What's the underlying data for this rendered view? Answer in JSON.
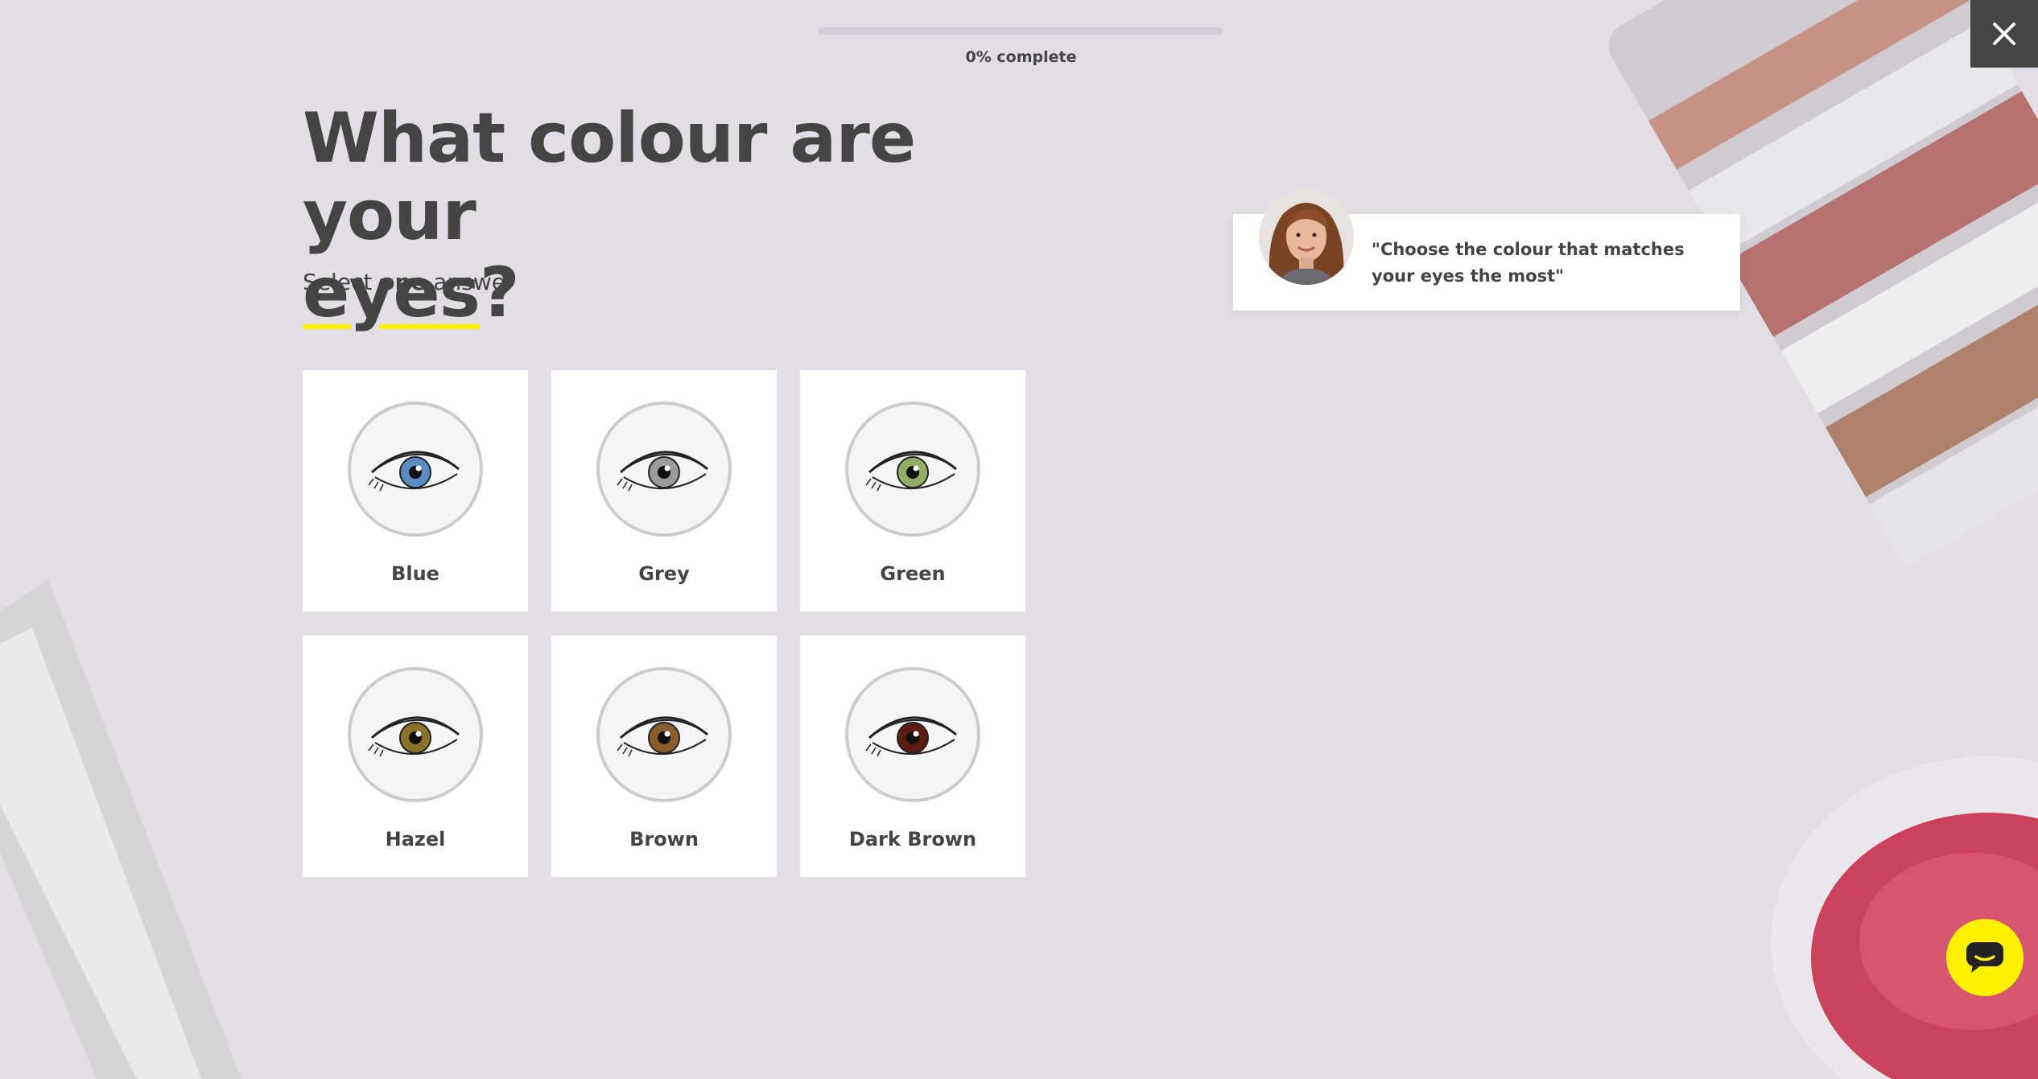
{
  "progress": {
    "text": "0% complete",
    "percent": 0
  },
  "question": {
    "title_part1": "What colour are your",
    "title_highlight": "eyes",
    "title_end": "?",
    "subtitle_before": "Select",
    "subtitle_bold": "one",
    "subtitle_after": "answer"
  },
  "options": [
    {
      "label": "Blue",
      "iris_color": "#5b8bbf"
    },
    {
      "label": "Grey",
      "iris_color": "#9a9a9a"
    },
    {
      "label": "Green",
      "iris_color": "#93ad64"
    },
    {
      "label": "Hazel",
      "iris_color": "#8a7128"
    },
    {
      "label": "Brown",
      "iris_color": "#8a5c2e"
    },
    {
      "label": "Dark Brown",
      "iris_color": "#5a1c0e"
    }
  ],
  "tip": {
    "text": "\"Choose the colour that matches your eyes the most\""
  },
  "icons": {
    "close": "close-icon",
    "chat": "chat-icon"
  },
  "colors": {
    "background": "#e3dee6",
    "text": "#444444",
    "accent": "#fff200",
    "card": "#ffffff"
  }
}
